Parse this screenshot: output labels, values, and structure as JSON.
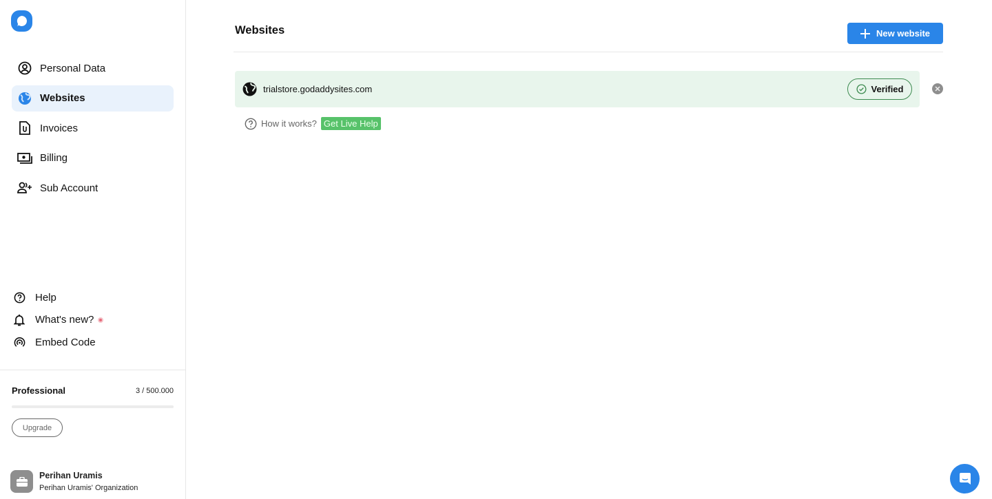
{
  "sidebar": {
    "logo": "app-logo",
    "nav": [
      {
        "label": "Personal Data",
        "icon": "user-circle-icon",
        "active": false
      },
      {
        "label": "Websites",
        "icon": "globe-icon",
        "active": true
      },
      {
        "label": "Invoices",
        "icon": "invoice-icon",
        "active": false
      },
      {
        "label": "Billing",
        "icon": "billing-icon",
        "active": false
      },
      {
        "label": "Sub Account",
        "icon": "add-user-icon",
        "active": false
      }
    ],
    "bottom_nav": [
      {
        "label": "Help",
        "icon": "help-icon"
      },
      {
        "label": "What's new?",
        "icon": "bell-icon",
        "badge": true
      },
      {
        "label": "Embed Code",
        "icon": "embed-icon"
      }
    ],
    "plan": {
      "name": "Professional",
      "usage": "3 / 500.000",
      "progress_percent": 0.0006,
      "upgrade_label": "Upgrade"
    },
    "user": {
      "name": "Perihan Uramis",
      "organization": "Perihan Uramis' Organization"
    }
  },
  "main": {
    "title": "Websites",
    "new_button_label": "New website",
    "websites": [
      {
        "url": "trialstore.godaddysites.com",
        "status": "Verified"
      }
    ],
    "how_it_works": "How it works?",
    "live_help": "Get Live Help"
  },
  "colors": {
    "accent": "#2a85e8",
    "verified_bg": "#e8f5ec",
    "verified_border": "#3c8a4f",
    "live_help_bg": "#57c26a"
  }
}
